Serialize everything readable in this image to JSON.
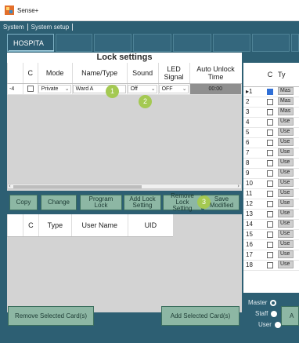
{
  "app": {
    "title": "Sense+"
  },
  "menu": {
    "items": [
      "System",
      "System setup"
    ]
  },
  "toolbar": {
    "active_tab": "HOSPITA"
  },
  "lock_settings": {
    "title": "Lock settings",
    "columns": [
      "",
      "C",
      "Mode",
      "Name/Type",
      "Sound",
      "LED Signal",
      "Auto Unlock Time"
    ],
    "row": {
      "index": "-4",
      "mode": "Private",
      "name": "Ward A",
      "sound": "Off",
      "led": "OFF",
      "time": "00:00"
    },
    "callouts": [
      "1",
      "2",
      "3"
    ]
  },
  "actions": {
    "copy": "Copy",
    "change": "Change",
    "program_lock": "Program Lock",
    "add_lock_setting": "Add Lock Setting",
    "remove_lock_setting": "Remove Lock Setting",
    "save_modified": "Save Modified"
  },
  "user_table": {
    "columns": [
      "",
      "C",
      "Type",
      "User Name",
      "UID"
    ]
  },
  "card_table": {
    "columns": [
      "",
      "C",
      "Ty"
    ],
    "rows": [
      {
        "n": "▸1",
        "type": "Mas"
      },
      {
        "n": "2",
        "type": "Mas"
      },
      {
        "n": "3",
        "type": "Mas"
      },
      {
        "n": "4",
        "type": "Use"
      },
      {
        "n": "5",
        "type": "Use"
      },
      {
        "n": "6",
        "type": "Use"
      },
      {
        "n": "7",
        "type": "Use"
      },
      {
        "n": "8",
        "type": "Use"
      },
      {
        "n": "9",
        "type": "Use"
      },
      {
        "n": "10",
        "type": "Use"
      },
      {
        "n": "11",
        "type": "Use"
      },
      {
        "n": "12",
        "type": "Use"
      },
      {
        "n": "13",
        "type": "Use"
      },
      {
        "n": "14",
        "type": "Use"
      },
      {
        "n": "15",
        "type": "Use"
      },
      {
        "n": "16",
        "type": "Use"
      },
      {
        "n": "17",
        "type": "Use"
      },
      {
        "n": "18",
        "type": "Use"
      }
    ]
  },
  "bottom": {
    "remove_selected": "Remove Selected Card(s)",
    "add_selected": "Add Selected Card(s)",
    "radio": {
      "master": "Master",
      "staff": "Staff",
      "user": "User",
      "selected": "Master"
    },
    "right_button": "A"
  },
  "colors": {
    "primary": "#2d5f73",
    "button": "#8db7a4",
    "callout": "#a4c952"
  }
}
